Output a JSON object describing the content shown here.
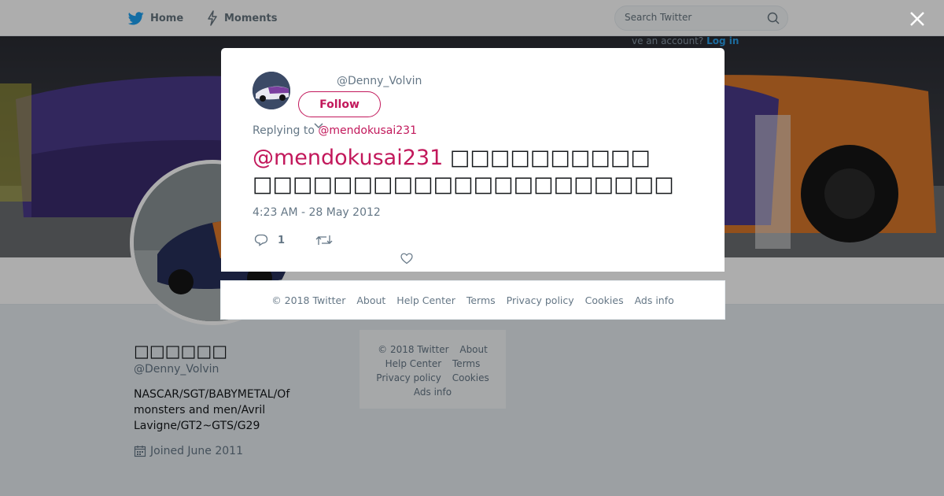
{
  "nav": {
    "home_label": "Home",
    "moments_label": "Moments",
    "search_placeholder": "Search Twitter",
    "login_hint_prefix": "ve an account?",
    "login_hint_link": "Log in"
  },
  "profile": {
    "name": "□□□□□□",
    "handle": "@Denny_Volvin",
    "bio": "NASCAR/SGT/BABYMETAL/Of monsters and men/Avril Lavigne/GT2~GTS/G29",
    "joined": "Joined June 2011"
  },
  "side_footer": {
    "copyright": "© 2018 Twitter",
    "about": "About",
    "help_center": "Help Center",
    "terms": "Terms",
    "privacy": "Privacy policy",
    "cookies": "Cookies",
    "ads_info": "Ads info"
  },
  "tweet": {
    "handle": "@Denny_Volvin",
    "follow_label": "Follow",
    "replying_prefix": "Replying to",
    "replying_to": "@mendokusai231",
    "mention": "@mendokusai231",
    "text_line1": "□□□□□□□□□□",
    "text_line2": "□□□□□□□□□□□□□□□□□□□□□",
    "time": "4:23 AM - 28 May 2012",
    "reply_count": "1"
  },
  "modal_footer": {
    "copyright": "© 2018 Twitter",
    "about": "About",
    "help_center": "Help Center",
    "terms": "Terms",
    "privacy": "Privacy policy",
    "cookies": "Cookies",
    "ads_info": "Ads info"
  },
  "colors": {
    "accent": "#c2185b",
    "twitter_blue": "#1da1f2",
    "secondary_text": "#657786"
  },
  "icons": [
    "twitter-bird-icon",
    "lightning-icon",
    "search-icon",
    "close-icon",
    "calendar-icon",
    "reply-icon",
    "retweet-icon",
    "heart-icon",
    "chevron-down-icon"
  ]
}
